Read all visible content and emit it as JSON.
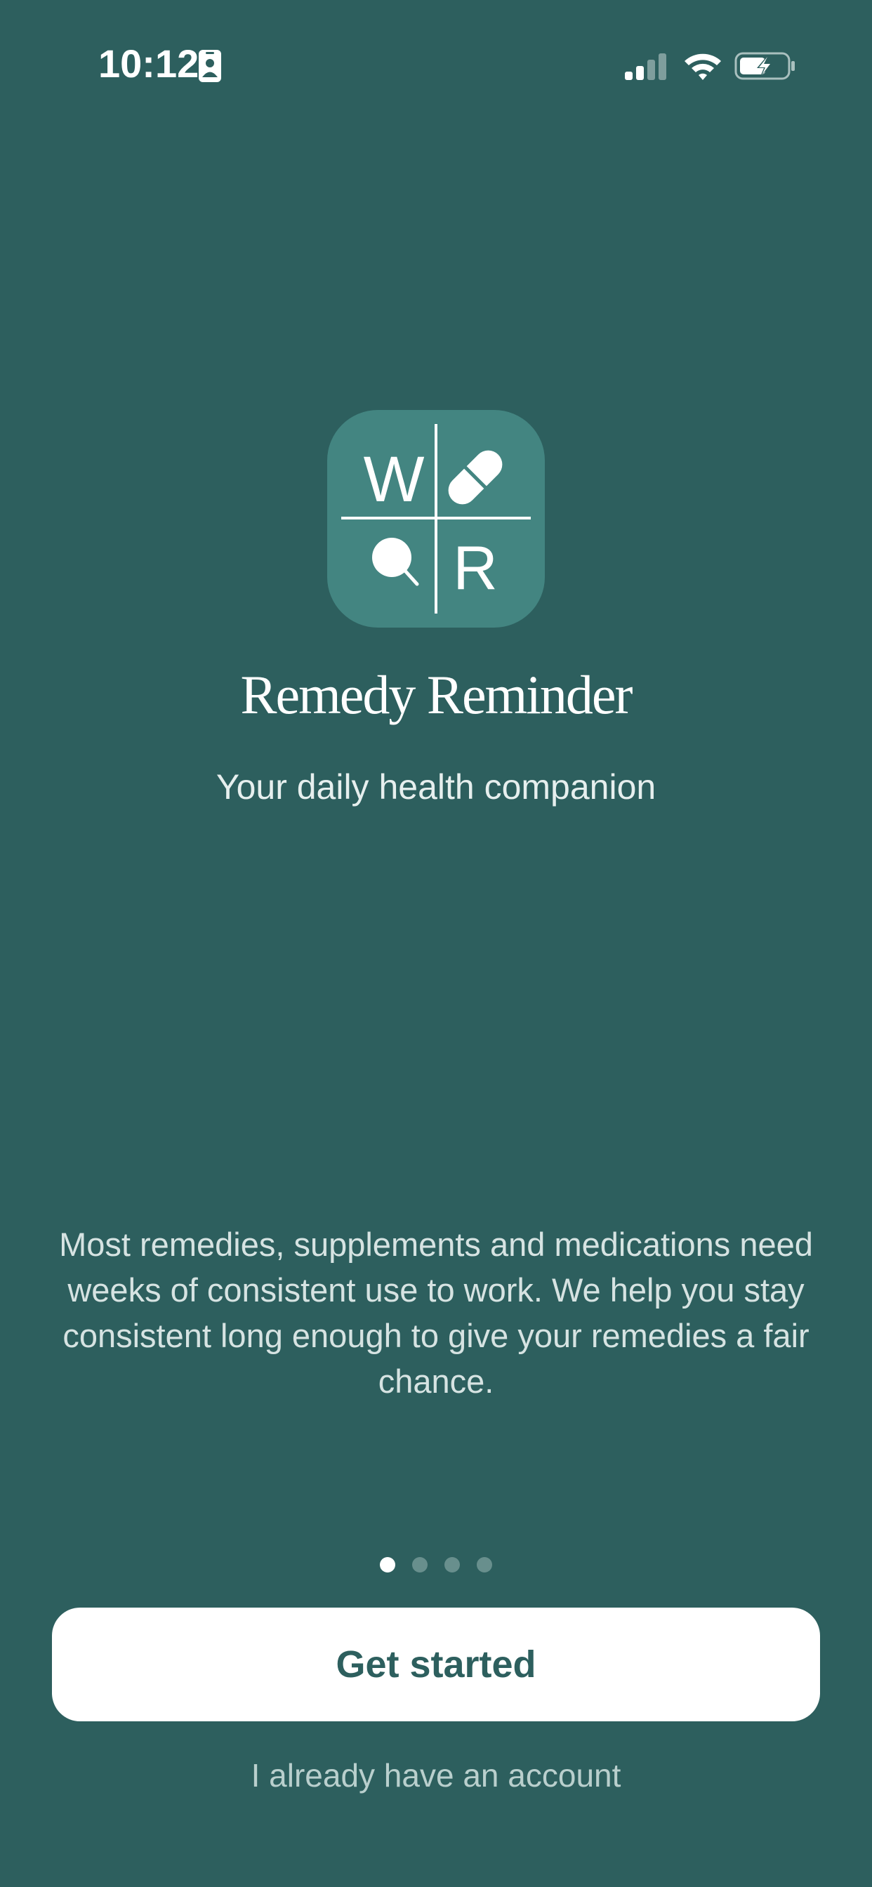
{
  "status_bar": {
    "time": "10:12",
    "id_icon": "person-card-icon",
    "signal_icon": "cellular-signal-icon",
    "wifi_icon": "wifi-icon",
    "battery_icon": "battery-charging-icon"
  },
  "logo": {
    "letter_top_left": "W",
    "letter_bottom_right": "R",
    "icon_top_right": "pill-icon",
    "icon_bottom_left": "magnifier-icon"
  },
  "welcome": {
    "title": "Remedy Reminder",
    "subtitle": "Your daily health companion",
    "description": "Most remedies, supplements and medications need weeks of consistent use to work. We help you stay consistent long enough to give your remedies a fair chance."
  },
  "pagination": {
    "total_pages": 4,
    "current_page": 1
  },
  "actions": {
    "primary_label": "Get started",
    "secondary_label": "I already have an account"
  },
  "colors": {
    "background": "#2d5f5e",
    "logo_background": "#438581",
    "button_background": "#ffffff",
    "button_text": "#2d5f5e"
  }
}
